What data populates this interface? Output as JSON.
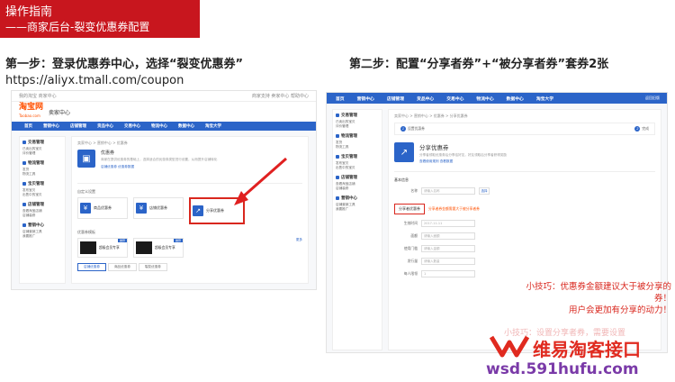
{
  "banner": {
    "title": "操作指南",
    "subtitle": "——商家后台-裂变优惠券配置"
  },
  "step1": {
    "text": "第一步：登录优惠券中心，选择“裂变优惠券”",
    "url": "https://aliyx.tmall.com/coupon"
  },
  "step2": {
    "text": "第二步：配置“分享者券”+“被分享者券”套券2张"
  },
  "left_shot": {
    "topstrip_left": "我的淘宝 商家中心",
    "topstrip_right": "商家支持 卖家中心 帮助中心",
    "logo": "淘宝网",
    "logo_sub": "Taobao.com",
    "center_name": "卖家中心",
    "nav": [
      "首页",
      "营销中心",
      "店铺管理",
      "货品中心",
      "交易中心",
      "物流中心",
      "数据中心",
      "淘宝大学"
    ],
    "sidebar": [
      {
        "head": "交易管理",
        "links": [
          "已卖出的宝贝",
          "评价管理"
        ]
      },
      {
        "head": "物流管理",
        "links": [
          "发货",
          "物流工具"
        ]
      },
      {
        "head": "宝贝管理",
        "links": [
          "发布宝贝",
          "出售中的宝贝"
        ]
      },
      {
        "head": "店铺管理",
        "links": [
          "查看淘宝店铺",
          "店铺装修"
        ]
      },
      {
        "head": "营销中心",
        "links": [
          "店铺营销工具",
          "我要推广"
        ]
      }
    ],
    "crumb": "卖家中心 > 营销中心 > 优惠券",
    "hero_title": "优惠券",
    "hero_desc": "商家在提供优惠券的基础上，选择适合的优惠券类型进行设置，从而提升店铺转化",
    "hero_links": "店铺优惠券 优惠券数据",
    "sec_title": "自定义设置",
    "cards": [
      "商品优惠券",
      "店铺优惠券",
      "分享优惠券"
    ],
    "sec2_title": "优惠券模板",
    "more": "更多",
    "biz_cards": [
      {
        "label": "超级会员专享",
        "tag": "推荐"
      },
      {
        "label": "超级会员专享",
        "tag": "推荐"
      }
    ],
    "tabs": [
      "店铺优惠券",
      "商品优惠券",
      "裂变优惠券"
    ]
  },
  "right_shot": {
    "nav": [
      "首页",
      "营销中心",
      "店铺管理",
      "货品中心",
      "交易中心",
      "物流中心",
      "数据中心",
      "淘宝大学"
    ],
    "return": "返回旧版",
    "crumb": "卖家中心 > 营销中心 > 优惠券 > 分享优惠券",
    "step_left": "设置优惠券",
    "step_right": "完成",
    "share_title": "分享优惠券",
    "share_desc": "分享者领取优惠券后分享给好友，好友领取后分享者获得奖励",
    "share_links": "查看使用规则  查看数据",
    "form_title": "基本信息",
    "fields": [
      {
        "label": "名称",
        "value": "请输入名称",
        "btn": "选择"
      },
      {
        "label": "生效时间",
        "value": "2017-11-11",
        "btn": ""
      },
      {
        "label": "面额",
        "value": "请输入面额",
        "btn": ""
      },
      {
        "label": "使用门槛",
        "value": "请输入金额",
        "btn": ""
      },
      {
        "label": "发行量",
        "value": "请输入数量",
        "btn": ""
      },
      {
        "label": "每人限领",
        "value": "1",
        "btn": ""
      }
    ],
    "tab_share": "分享者优惠券",
    "tab_hint": "分享者券金额需要大于被分享者券"
  },
  "tip": {
    "line1": "小技巧：优惠券金额建议大于被分享的券！",
    "line2": "用户会更加有分享的动力！"
  },
  "watermark": {
    "brand": "维易淘客接口",
    "site": "wsd.591hufu.com",
    "faint": "小技巧：设置分享者券，需要设置"
  },
  "colors": {
    "accent": "#c8161e",
    "nav_blue": "#2b64c8",
    "highlight": "#d9271e"
  }
}
